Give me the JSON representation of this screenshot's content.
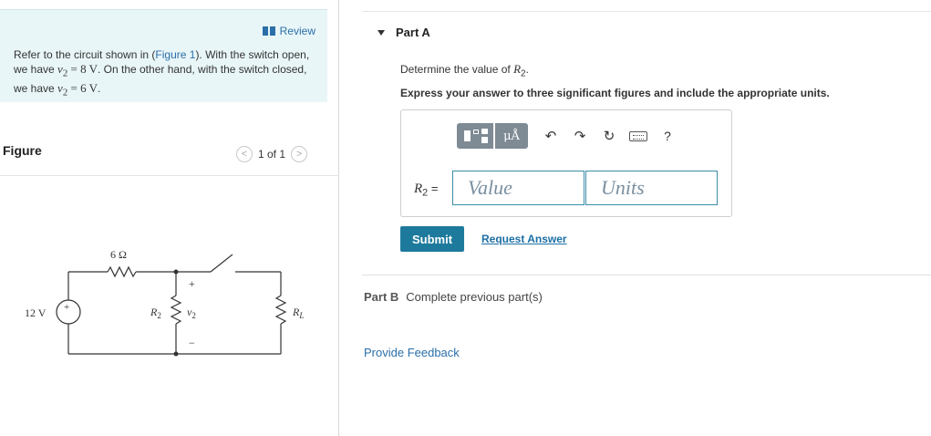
{
  "review": {
    "label": "Review"
  },
  "problem": {
    "t1": "Refer to the circuit shown in (",
    "link": "Figure 1",
    "t2": "). With the switch open, we have ",
    "v2a": "v",
    "sub_a": "2",
    "eq_a": " = 8 V",
    "t3": ". On the other hand, with the switch closed, we have ",
    "v2b": "v",
    "sub_b": "2",
    "eq_b": " = 6 V",
    "t4": "."
  },
  "figure": {
    "title": "Figure",
    "pager": "1 of 1",
    "prev_icon": "chevron-left-icon",
    "next_icon": "chevron-right-icon",
    "circuit": {
      "r_series": "6 Ω",
      "source": "12 V",
      "source_plus": "+",
      "r2": "R",
      "r2_sub": "2",
      "v2": "v",
      "v2_sub": "2",
      "plus": "+",
      "minus": "−",
      "rl": "R",
      "rl_sub": "L"
    }
  },
  "partA": {
    "title": "Part A",
    "question_prefix": "Determine the value of ",
    "var": "R",
    "var_sub": "2",
    "question_suffix": ".",
    "instruction": "Express your answer to three significant figures and include the appropriate units.",
    "eq_var": "R",
    "eq_sub": "2",
    "eq_sign": " =",
    "value_placeholder": "Value",
    "units_placeholder": "Units",
    "toolbar": {
      "units_label": "μÅ",
      "undo_icon": "↶",
      "redo_icon": "↷",
      "reset_icon": "↻",
      "help_label": "?"
    },
    "submit": "Submit",
    "request": "Request Answer"
  },
  "partB": {
    "label": "Part B",
    "text": "Complete previous part(s)"
  },
  "feedback": "Provide Feedback",
  "colors": {
    "accent": "#1d7a9c",
    "link": "#2a6fa8",
    "review_bg": "#e9f6f8"
  }
}
